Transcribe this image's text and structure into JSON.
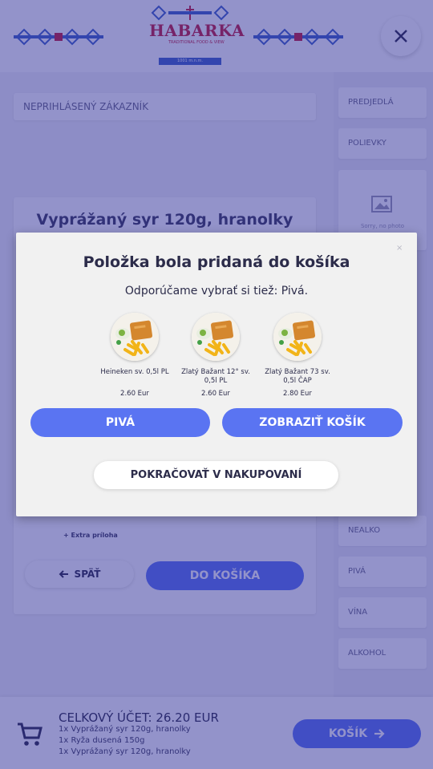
{
  "header": {
    "logo_name": "HABARKA",
    "logo_sub": "TRADITIONAL FOOD & VIEW",
    "logo_bar": "1001 m.n.m.",
    "colors": {
      "brand_red": "#c41e3a",
      "ornament_blue": "#3f63c6"
    }
  },
  "customer": {
    "label": "NEPRIHLÁSENÝ ZÁKAZNÍK"
  },
  "product": {
    "title": "Vyprážaný syr 120g, hranolky",
    "extra_link": "+ Extra príloha",
    "back_label": "SPÄŤ",
    "add_label": "DO KOŠÍKA"
  },
  "sidebar": {
    "categories": [
      "PREDJEDLÁ",
      "POLIEVKY",
      "NEALKO",
      "PIVÁ",
      "VÍNA",
      "ALKOHOL"
    ],
    "photo_placeholder": "Sorry, no photo"
  },
  "cart": {
    "total": "CELKOVÝ ÚČET: 26.20 EUR",
    "items": [
      "1x Vyprážaný syr 120g, hranolky",
      "1x Ryža dusená 150g",
      "1x Vyprážaný syr 120g, hranolky"
    ],
    "button_label": "KOŠÍK"
  },
  "modal": {
    "close_glyph": "×",
    "title": "Položka bola pridaná do košíka",
    "subtitle": "Odporúčame vybrať si tiež: Pivá.",
    "recommendations": [
      {
        "name": "Heineken sv. 0,5l PL",
        "price": "2.60 Eur"
      },
      {
        "name": "Zlatý Bažant 12° sv. 0,5l PL",
        "price": "2.60 Eur"
      },
      {
        "name": "Zlatý Bažant 73 sv. 0,5l ČAP",
        "price": "2.80 Eur"
      }
    ],
    "btn_category": "PIVÁ",
    "btn_show_cart": "ZOBRAZIŤ KOŠÍK",
    "btn_continue": "POKRAČOVAŤ V NAKUPOVANÍ"
  },
  "colors": {
    "accent": "#5a74f2",
    "overlay": "rgba(40,40,150,0.5)",
    "text": "#2c2c4a"
  }
}
